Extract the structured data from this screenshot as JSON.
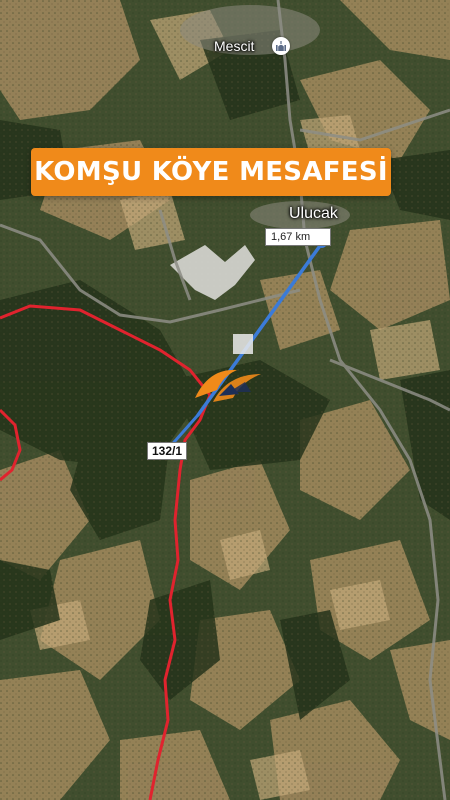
{
  "title_banner": {
    "text": "KOMŞU KÖYE MESAFESİ"
  },
  "places": {
    "mescit": "Mescit",
    "ulucak": "Ulucak"
  },
  "measurement": {
    "distance_label": "1,67 km"
  },
  "parcel": {
    "label": "132/1"
  },
  "icons": {
    "place_of_worship": "mosque-icon",
    "brand_logo": "logo-mark"
  },
  "colors": {
    "banner": "#f08a1a",
    "boundary": "#e0232e",
    "measure_line": "#3b7bd8",
    "logo_orange": "#f08a1a",
    "logo_navy": "#1d2f57"
  }
}
